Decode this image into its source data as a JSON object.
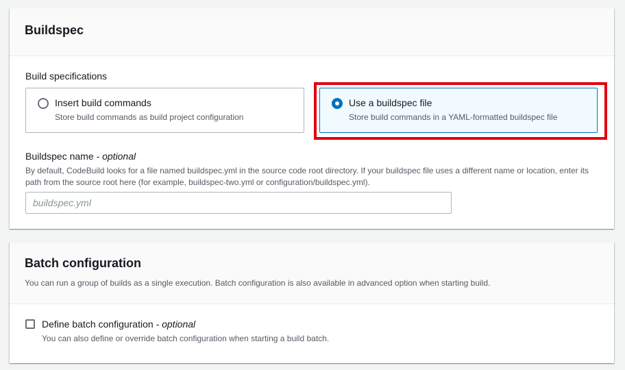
{
  "buildspec": {
    "title": "Buildspec",
    "build_specifications_label": "Build specifications",
    "options": [
      {
        "label": "Insert build commands",
        "description": "Store build commands as build project configuration",
        "selected": false
      },
      {
        "label": "Use a buildspec file",
        "description": "Store build commands in a YAML-formatted buildspec file",
        "selected": true
      }
    ],
    "name_field": {
      "label": "Buildspec name",
      "optional": " - optional",
      "help": "By default, CodeBuild looks for a file named buildspec.yml in the source code root directory. If your buildspec file uses a different name or location, enter its path from the source root here (for example, buildspec-two.yml or configuration/buildspec.yml).",
      "placeholder": "buildspec.yml",
      "value": ""
    }
  },
  "batch": {
    "title": "Batch configuration",
    "description": "You can run a group of builds as a single execution. Batch configuration is also available in advanced option when starting build.",
    "checkbox": {
      "label": "Define batch configuration",
      "optional": " - optional",
      "description": "You can also define or override batch configuration when starting a build batch.",
      "checked": false
    }
  },
  "colors": {
    "accent": "#0073bb",
    "highlight": "#e1000d"
  }
}
